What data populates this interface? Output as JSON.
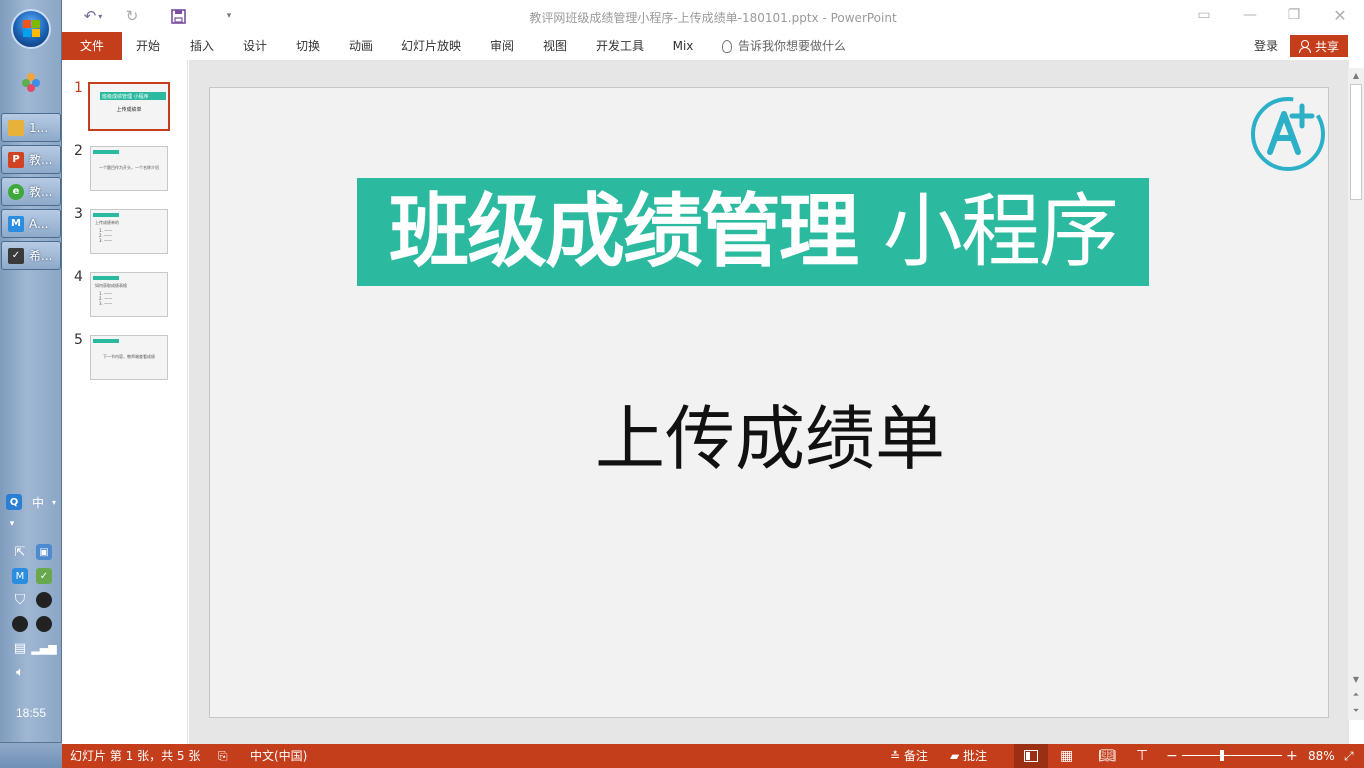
{
  "taskbar": {
    "tasks": [
      {
        "label": "1...",
        "icon": "folder-icon",
        "color": "#e8b23a"
      },
      {
        "label": "教...",
        "icon": "powerpoint-icon",
        "color": "#d04423",
        "glyph": "P"
      },
      {
        "label": "教...",
        "icon": "browser-icon",
        "color": "#3fa83a",
        "glyph": "e"
      },
      {
        "label": "A...",
        "icon": "app-icon",
        "color": "#2a8de0",
        "glyph": "M"
      },
      {
        "label": "希...",
        "icon": "checkbox-app-icon",
        "color": "#3a3a3a",
        "glyph": "✓"
      }
    ],
    "ime_label": "中",
    "clock": "18:55"
  },
  "window": {
    "title": "教评网班级成绩管理小程序-上传成绩单-180101.pptx - PowerPoint"
  },
  "ribbon": {
    "file": "文件",
    "tabs": [
      "开始",
      "插入",
      "设计",
      "切换",
      "动画",
      "幻灯片放映",
      "审阅",
      "视图",
      "开发工具",
      "Mix"
    ],
    "tell_me": "告诉我你想要做什么",
    "login": "登录",
    "share": "共享"
  },
  "thumbnails": [
    {
      "num": "1",
      "text": "上传成绩单",
      "header": "班级成绩管理 小程序"
    },
    {
      "num": "2",
      "text": "一个题目作为开头，一个名称介绍",
      "header": ""
    },
    {
      "num": "3",
      "text": "上传成绩单的"
    },
    {
      "num": "4",
      "text": "如何获取成绩表格"
    },
    {
      "num": "5",
      "text": "下一节内容，教师端查看成绩"
    }
  ],
  "slide": {
    "title_bold": "班级成绩管理",
    "title_light": "小程序",
    "subtitle": "上传成绩单",
    "accent": "#2bbaa0"
  },
  "status": {
    "slide_info": "幻灯片 第 1 张，共 5 张",
    "language": "中文(中国)",
    "notes": "备注",
    "comments": "批注",
    "zoom": "88%",
    "bar_color": "#c43e1c"
  }
}
